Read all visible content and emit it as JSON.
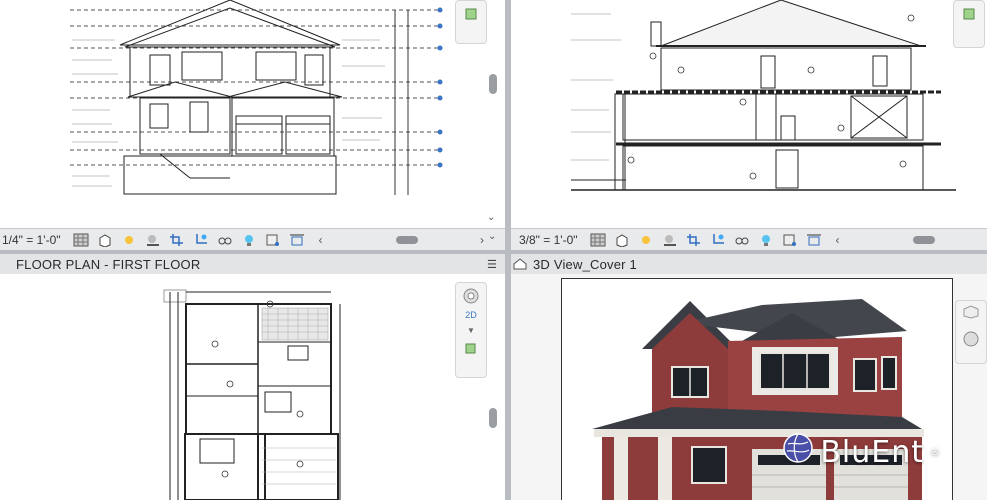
{
  "views": {
    "top_left": {
      "scale": "1/4\" = 1'-0\""
    },
    "top_right": {
      "scale": "3/8\" = 1'-0\""
    },
    "bottom_left": {
      "title": "FLOOR PLAN - FIRST FLOOR"
    },
    "bottom_right": {
      "title": "3D View_Cover 1"
    }
  },
  "nav": {
    "label_2d": "2D"
  },
  "brand": {
    "name": "BluEnt",
    "trademark": "®"
  },
  "colors": {
    "accent": "#3a76c4",
    "brick": "#8e3b3b",
    "roof": "#3b3d44",
    "logo": "#ffffff"
  }
}
